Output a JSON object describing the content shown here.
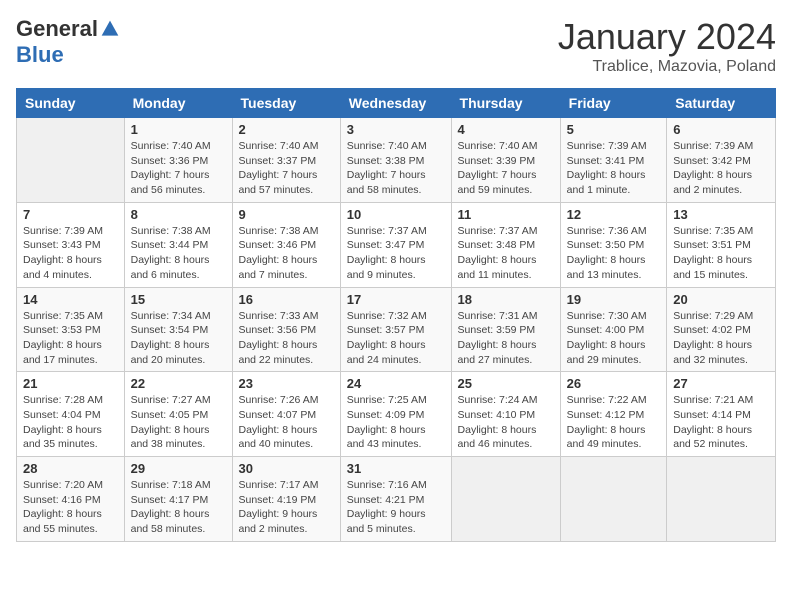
{
  "header": {
    "logo_general": "General",
    "logo_blue": "Blue",
    "title": "January 2024",
    "subtitle": "Trablice, Mazovia, Poland"
  },
  "weekdays": [
    "Sunday",
    "Monday",
    "Tuesday",
    "Wednesday",
    "Thursday",
    "Friday",
    "Saturday"
  ],
  "weeks": [
    [
      {
        "day": "",
        "info": ""
      },
      {
        "day": "1",
        "info": "Sunrise: 7:40 AM\nSunset: 3:36 PM\nDaylight: 7 hours\nand 56 minutes."
      },
      {
        "day": "2",
        "info": "Sunrise: 7:40 AM\nSunset: 3:37 PM\nDaylight: 7 hours\nand 57 minutes."
      },
      {
        "day": "3",
        "info": "Sunrise: 7:40 AM\nSunset: 3:38 PM\nDaylight: 7 hours\nand 58 minutes."
      },
      {
        "day": "4",
        "info": "Sunrise: 7:40 AM\nSunset: 3:39 PM\nDaylight: 7 hours\nand 59 minutes."
      },
      {
        "day": "5",
        "info": "Sunrise: 7:39 AM\nSunset: 3:41 PM\nDaylight: 8 hours\nand 1 minute."
      },
      {
        "day": "6",
        "info": "Sunrise: 7:39 AM\nSunset: 3:42 PM\nDaylight: 8 hours\nand 2 minutes."
      }
    ],
    [
      {
        "day": "7",
        "info": "Sunrise: 7:39 AM\nSunset: 3:43 PM\nDaylight: 8 hours\nand 4 minutes."
      },
      {
        "day": "8",
        "info": "Sunrise: 7:38 AM\nSunset: 3:44 PM\nDaylight: 8 hours\nand 6 minutes."
      },
      {
        "day": "9",
        "info": "Sunrise: 7:38 AM\nSunset: 3:46 PM\nDaylight: 8 hours\nand 7 minutes."
      },
      {
        "day": "10",
        "info": "Sunrise: 7:37 AM\nSunset: 3:47 PM\nDaylight: 8 hours\nand 9 minutes."
      },
      {
        "day": "11",
        "info": "Sunrise: 7:37 AM\nSunset: 3:48 PM\nDaylight: 8 hours\nand 11 minutes."
      },
      {
        "day": "12",
        "info": "Sunrise: 7:36 AM\nSunset: 3:50 PM\nDaylight: 8 hours\nand 13 minutes."
      },
      {
        "day": "13",
        "info": "Sunrise: 7:35 AM\nSunset: 3:51 PM\nDaylight: 8 hours\nand 15 minutes."
      }
    ],
    [
      {
        "day": "14",
        "info": "Sunrise: 7:35 AM\nSunset: 3:53 PM\nDaylight: 8 hours\nand 17 minutes."
      },
      {
        "day": "15",
        "info": "Sunrise: 7:34 AM\nSunset: 3:54 PM\nDaylight: 8 hours\nand 20 minutes."
      },
      {
        "day": "16",
        "info": "Sunrise: 7:33 AM\nSunset: 3:56 PM\nDaylight: 8 hours\nand 22 minutes."
      },
      {
        "day": "17",
        "info": "Sunrise: 7:32 AM\nSunset: 3:57 PM\nDaylight: 8 hours\nand 24 minutes."
      },
      {
        "day": "18",
        "info": "Sunrise: 7:31 AM\nSunset: 3:59 PM\nDaylight: 8 hours\nand 27 minutes."
      },
      {
        "day": "19",
        "info": "Sunrise: 7:30 AM\nSunset: 4:00 PM\nDaylight: 8 hours\nand 29 minutes."
      },
      {
        "day": "20",
        "info": "Sunrise: 7:29 AM\nSunset: 4:02 PM\nDaylight: 8 hours\nand 32 minutes."
      }
    ],
    [
      {
        "day": "21",
        "info": "Sunrise: 7:28 AM\nSunset: 4:04 PM\nDaylight: 8 hours\nand 35 minutes."
      },
      {
        "day": "22",
        "info": "Sunrise: 7:27 AM\nSunset: 4:05 PM\nDaylight: 8 hours\nand 38 minutes."
      },
      {
        "day": "23",
        "info": "Sunrise: 7:26 AM\nSunset: 4:07 PM\nDaylight: 8 hours\nand 40 minutes."
      },
      {
        "day": "24",
        "info": "Sunrise: 7:25 AM\nSunset: 4:09 PM\nDaylight: 8 hours\nand 43 minutes."
      },
      {
        "day": "25",
        "info": "Sunrise: 7:24 AM\nSunset: 4:10 PM\nDaylight: 8 hours\nand 46 minutes."
      },
      {
        "day": "26",
        "info": "Sunrise: 7:22 AM\nSunset: 4:12 PM\nDaylight: 8 hours\nand 49 minutes."
      },
      {
        "day": "27",
        "info": "Sunrise: 7:21 AM\nSunset: 4:14 PM\nDaylight: 8 hours\nand 52 minutes."
      }
    ],
    [
      {
        "day": "28",
        "info": "Sunrise: 7:20 AM\nSunset: 4:16 PM\nDaylight: 8 hours\nand 55 minutes."
      },
      {
        "day": "29",
        "info": "Sunrise: 7:18 AM\nSunset: 4:17 PM\nDaylight: 8 hours\nand 58 minutes."
      },
      {
        "day": "30",
        "info": "Sunrise: 7:17 AM\nSunset: 4:19 PM\nDaylight: 9 hours\nand 2 minutes."
      },
      {
        "day": "31",
        "info": "Sunrise: 7:16 AM\nSunset: 4:21 PM\nDaylight: 9 hours\nand 5 minutes."
      },
      {
        "day": "",
        "info": ""
      },
      {
        "day": "",
        "info": ""
      },
      {
        "day": "",
        "info": ""
      }
    ]
  ]
}
